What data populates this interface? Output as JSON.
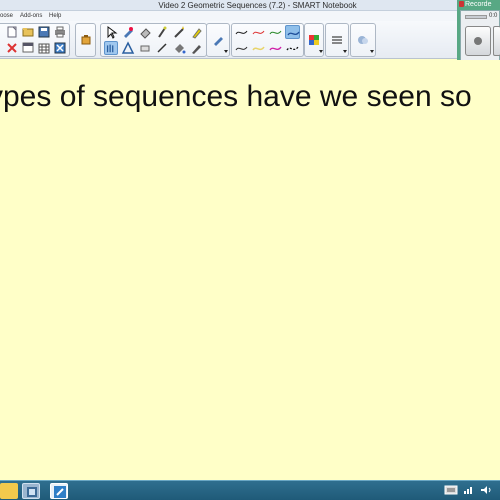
{
  "window": {
    "title": "Video 2 Geometric Sequences (7.2) - SMART Notebook"
  },
  "menu": {
    "items": [
      "oose",
      "Add-ons",
      "Help"
    ]
  },
  "toolbar": {
    "file_buttons": [
      "new-page-icon",
      "open-icon",
      "save-icon",
      "print-icon",
      "delete-icon",
      "screen-shade-icon",
      "table-icon",
      "fullscreen-icon",
      "undo-icon"
    ],
    "document_camera_icon": "document-camera-icon",
    "tools": [
      "select-icon",
      "pen-icon",
      "eraser-icon",
      "magic-pen-icon",
      "magic-wand-icon",
      "highlighter-icon",
      "creative-pen-icon",
      "shapes-icon",
      "eraser-tool-icon",
      "line-icon",
      "fill-icon",
      "text-pen-icon"
    ],
    "line_styles": [
      "thin-black-line",
      "thin-red-line",
      "thin-green-line",
      "thin-blue-line",
      "thin-dark-line",
      "thin-yellow-line",
      "thin-magenta-line",
      "dashed-black-line"
    ],
    "properties": [
      "pen-properties-icon",
      "color-palette-icon",
      "line-style-icon",
      "fill-effects-icon"
    ],
    "active_line_color": "#8fbfea"
  },
  "recorder": {
    "title": "Recorde",
    "time": "0:0"
  },
  "canvas": {
    "background": "#ffffc8",
    "heading": "ypes of sequences have we seen so"
  },
  "taskbar": {
    "items": [
      "folder-icon",
      "smart-notebook-icon",
      "notes-icon"
    ],
    "tray": [
      "keyboard-icon",
      "network-icon",
      "volume-icon"
    ]
  }
}
